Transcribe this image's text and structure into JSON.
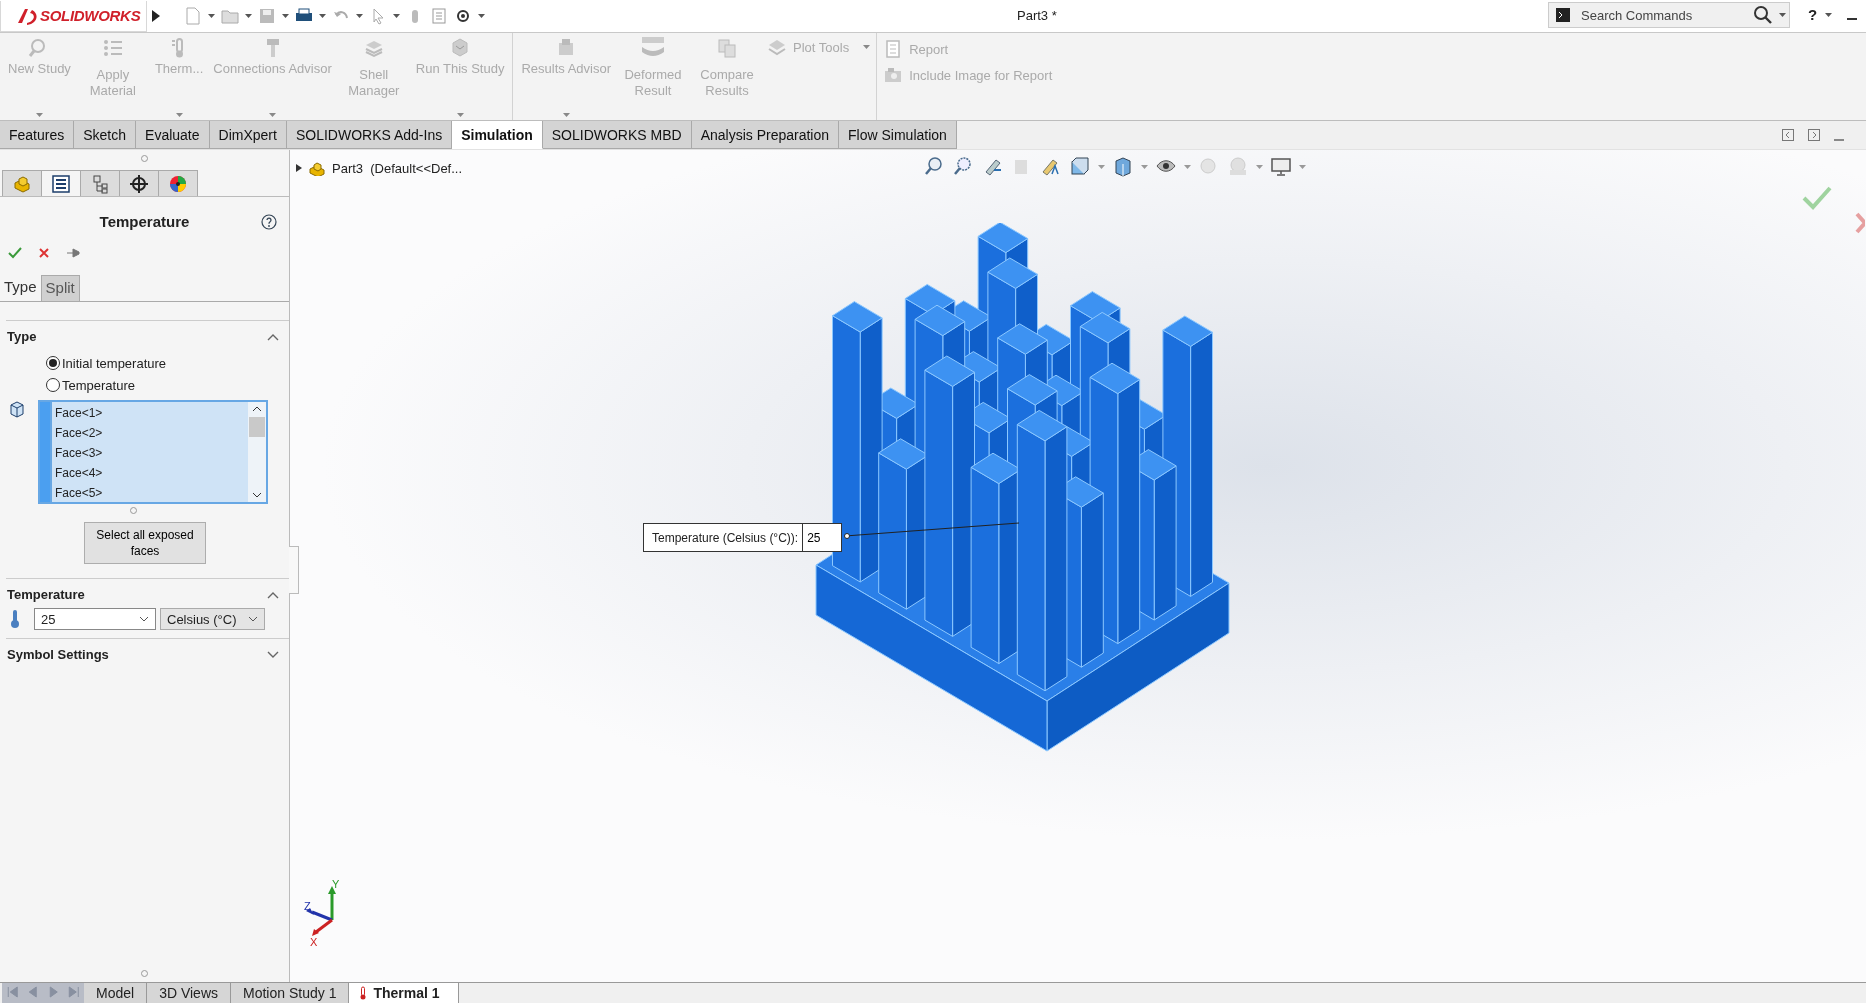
{
  "title_bar": {
    "logo": "SOLIDWORKS",
    "document_title": "Part3 *",
    "search": {
      "placeholder": "Search Commands"
    },
    "help": "?"
  },
  "ribbon": {
    "groups": [
      [
        {
          "label": "New Study",
          "kind": "large",
          "disabled": true,
          "dropdown": true
        },
        {
          "label": "Apply Material",
          "kind": "stacked",
          "disabled": true,
          "dropdown": false
        },
        {
          "label": "Therm...",
          "kind": "large",
          "disabled": true,
          "dropdown": true
        },
        {
          "label": "Connections Advisor",
          "kind": "large",
          "disabled": true,
          "dropdown": true
        },
        {
          "label": "Shell Manager",
          "kind": "stacked",
          "disabled": true,
          "dropdown": false
        },
        {
          "label": "Run This Study",
          "kind": "large",
          "disabled": true,
          "dropdown": true
        }
      ],
      [
        {
          "label": "Results Advisor",
          "kind": "large",
          "disabled": true,
          "dropdown": true
        },
        {
          "label": "Deformed Result",
          "kind": "stacked",
          "disabled": true,
          "dropdown": false
        },
        {
          "label": "Compare Results",
          "kind": "stacked",
          "disabled": true,
          "dropdown": false
        },
        {
          "label": "Plot Tools",
          "kind": "small",
          "disabled": true,
          "dropdown": true
        }
      ],
      [
        {
          "label": "Report",
          "kind": "small",
          "disabled": true,
          "dropdown": false
        },
        {
          "label": "Include Image for Report",
          "kind": "small",
          "disabled": true,
          "dropdown": false
        }
      ]
    ]
  },
  "command_tabs": [
    {
      "label": "Features",
      "selected": false
    },
    {
      "label": "Sketch",
      "selected": false
    },
    {
      "label": "Evaluate",
      "selected": false
    },
    {
      "label": "DimXpert",
      "selected": false
    },
    {
      "label": "SOLIDWORKS Add-Ins",
      "selected": false
    },
    {
      "label": "Simulation",
      "selected": true
    },
    {
      "label": "SOLIDWORKS MBD",
      "selected": false
    },
    {
      "label": "Analysis Preparation",
      "selected": false
    },
    {
      "label": "Flow Simulation",
      "selected": false
    }
  ],
  "property_manager": {
    "panel_tabs": [
      {
        "kind": "feature-tree",
        "selected": false
      },
      {
        "kind": "property",
        "selected": true
      },
      {
        "kind": "configuration",
        "selected": false
      },
      {
        "kind": "dimxpert",
        "selected": false
      },
      {
        "kind": "display",
        "selected": false
      }
    ],
    "title": "Temperature",
    "sub_tabs": [
      {
        "label": "Type",
        "selected": true
      },
      {
        "label": "Split",
        "selected": false
      }
    ],
    "type_section": {
      "title": "Type",
      "expanded": true,
      "options": [
        {
          "label": "Initial temperature",
          "selected": true
        },
        {
          "label": "Temperature",
          "selected": false
        }
      ],
      "faces": [
        "Face<1>",
        "Face<2>",
        "Face<3>",
        "Face<4>",
        "Face<5>"
      ],
      "button": "Select all exposed faces"
    },
    "temperature_section": {
      "title": "Temperature",
      "expanded": true,
      "value": "25",
      "unit": "Celsius (°C)"
    },
    "symbol_section": {
      "title": "Symbol Settings",
      "expanded": false
    }
  },
  "viewport": {
    "tree_root": "Part3  (Default<<Def...",
    "callout": {
      "label": "Temperature (Celsius (°C)):",
      "value": "25"
    },
    "axes": [
      "Y",
      "Z",
      "X"
    ]
  },
  "bottom_tabs": [
    {
      "label": "Model",
      "selected": false
    },
    {
      "label": "3D Views",
      "selected": false
    },
    {
      "label": "Motion Study 1",
      "selected": false
    },
    {
      "label": "Thermal 1",
      "selected": true
    }
  ]
}
